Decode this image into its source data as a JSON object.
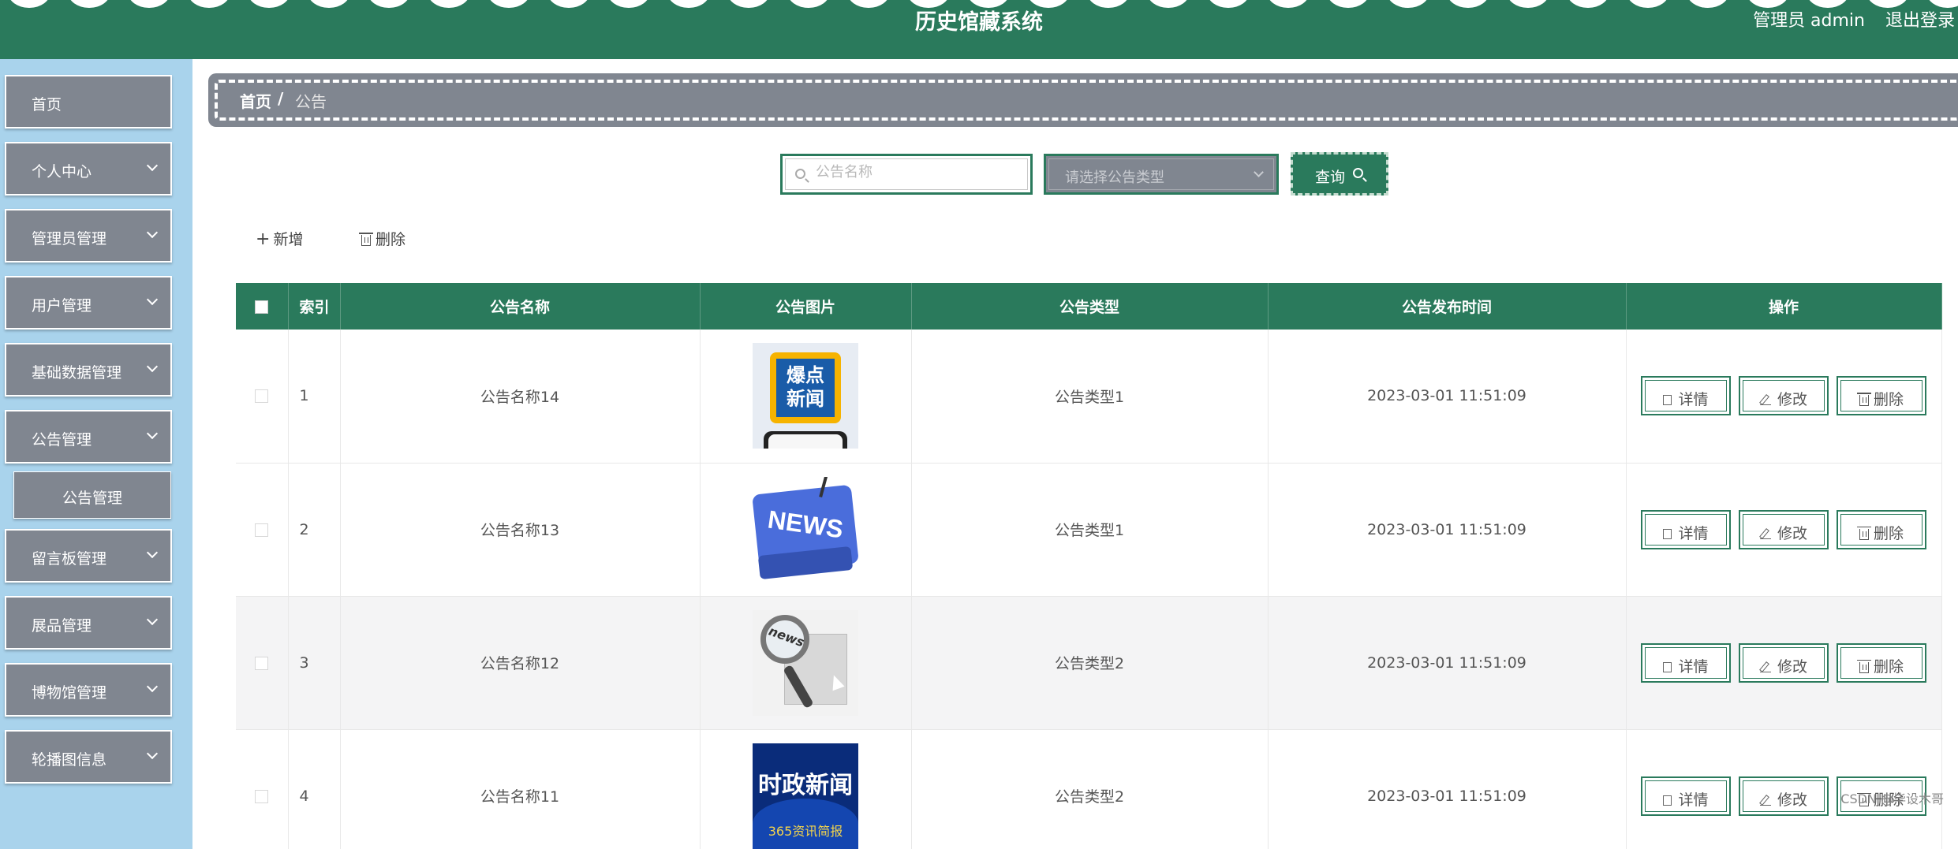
{
  "header": {
    "title": "历史馆藏系统",
    "user": "管理员 admin",
    "logout": "退出登录"
  },
  "sidebar": {
    "items": [
      {
        "label": "首页",
        "has_chevron": false
      },
      {
        "label": "个人中心",
        "has_chevron": true
      },
      {
        "label": "管理员管理",
        "has_chevron": true
      },
      {
        "label": "用户管理",
        "has_chevron": true
      },
      {
        "label": "基础数据管理",
        "has_chevron": true
      },
      {
        "label": "公告管理",
        "has_chevron": true
      },
      {
        "label": "留言板管理",
        "has_chevron": true
      },
      {
        "label": "展品管理",
        "has_chevron": true
      },
      {
        "label": "博物馆管理",
        "has_chevron": true
      },
      {
        "label": "轮播图信息",
        "has_chevron": true
      }
    ],
    "submenu": {
      "label": "公告管理"
    }
  },
  "breadcrumb": {
    "home": "首页",
    "sep": "/",
    "current": "公告"
  },
  "search": {
    "name_placeholder": "公告名称",
    "type_placeholder": "请选择公告类型",
    "query_label": "查询"
  },
  "actions": {
    "add_label": "新增",
    "delete_label": "删除"
  },
  "table": {
    "headers": [
      "",
      "索引",
      "公告名称",
      "公告图片",
      "公告类型",
      "公告发布时间",
      "操作"
    ],
    "rows": [
      {
        "index": "1",
        "name": "公告名称14",
        "image": "news-badge-image",
        "type": "公告类型1",
        "time": "2023-03-01 11:51:09"
      },
      {
        "index": "2",
        "name": "公告名称13",
        "image": "news-key-image",
        "type": "公告类型1",
        "time": "2023-03-01 11:51:09"
      },
      {
        "index": "3",
        "name": "公告名称12",
        "image": "news-magnifier-image",
        "type": "公告类型2",
        "time": "2023-03-01 11:51:09"
      },
      {
        "index": "4",
        "name": "公告名称11",
        "image": "current-news-image",
        "type": "公告类型2",
        "time": "2023-03-01 11:51:09"
      }
    ],
    "ops": {
      "detail": "详情",
      "edit": "修改",
      "delete": "删除"
    }
  },
  "thumbnails": {
    "badge_top": "爆点",
    "badge_bottom": "新闻",
    "key_text": "NEWS",
    "magnifier_text": "news",
    "current_title": "时政新闻",
    "current_sub": "365资讯简报"
  },
  "watermark": "CSDN @毕设木哥",
  "colors": {
    "theme_green": "#2a7a5c",
    "sidebar_bg": "#a9d3ec",
    "menu_gray": "#808690"
  }
}
